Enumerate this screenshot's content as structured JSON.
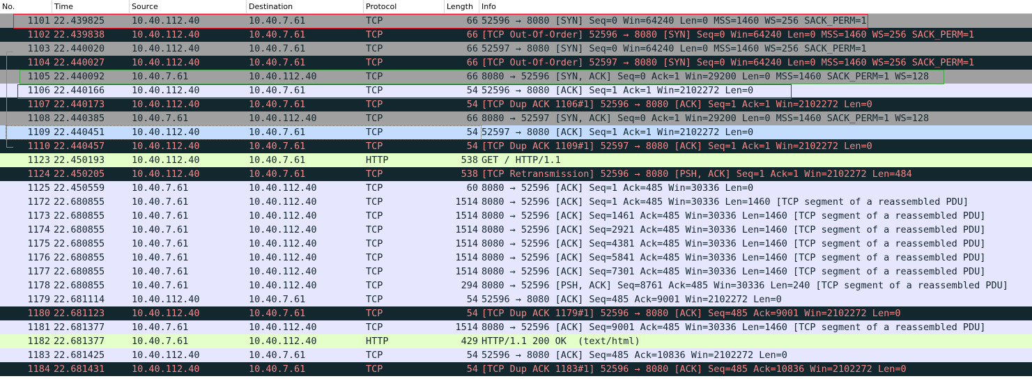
{
  "columns": {
    "no": "No.",
    "time": "Time",
    "source": "Source",
    "destination": "Destination",
    "protocol": "Protocol",
    "length": "Length",
    "info": "Info"
  },
  "colors": {
    "tcp_syn_bg": "#a0a0a0",
    "tcp_syn_fg": "#12272e",
    "tcp_bad_bg": "#12272e",
    "tcp_bad_fg": "#f78787",
    "tcp_bg": "#e7e6ff",
    "tcp_fg": "#12272e",
    "http_bg": "#e4ffc7",
    "http_fg": "#12272e",
    "selected_bg": "#c4dcff",
    "red_box": "#e8102a",
    "green_box": "#49a64b",
    "blue_box": "#3a3a8a"
  },
  "packets": [
    {
      "no": "1101",
      "time": "22.439825",
      "src": "10.40.112.40",
      "dst": "10.40.7.61",
      "proto": "TCP",
      "len": "66",
      "info": "52596 → 8080 [SYN] Seq=0 Win=64240 Len=0 MSS=1460 WS=256 SACK_PERM=1",
      "style": "syn"
    },
    {
      "no": "1102",
      "time": "22.439838",
      "src": "10.40.112.40",
      "dst": "10.40.7.61",
      "proto": "TCP",
      "len": "66",
      "info": "[TCP Out-Of-Order] 52596 → 8080 [SYN] Seq=0 Win=64240 Len=0 MSS=1460 WS=256 SACK_PERM=1",
      "style": "bad"
    },
    {
      "no": "1103",
      "time": "22.440020",
      "src": "10.40.112.40",
      "dst": "10.40.7.61",
      "proto": "TCP",
      "len": "66",
      "info": "52597 → 8080 [SYN] Seq=0 Win=64240 Len=0 MSS=1460 WS=256 SACK_PERM=1",
      "style": "syn"
    },
    {
      "no": "1104",
      "time": "22.440027",
      "src": "10.40.112.40",
      "dst": "10.40.7.61",
      "proto": "TCP",
      "len": "66",
      "info": "[TCP Out-Of-Order] 52597 → 8080 [SYN] Seq=0 Win=64240 Len=0 MSS=1460 WS=256 SACK_PERM=1",
      "style": "bad"
    },
    {
      "no": "1105",
      "time": "22.440092",
      "src": "10.40.7.61",
      "dst": "10.40.112.40",
      "proto": "TCP",
      "len": "66",
      "info": "8080 → 52596 [SYN, ACK] Seq=0 Ack=1 Win=29200 Len=0 MSS=1460 SACK_PERM=1 WS=128",
      "style": "syn"
    },
    {
      "no": "1106",
      "time": "22.440166",
      "src": "10.40.112.40",
      "dst": "10.40.7.61",
      "proto": "TCP",
      "len": "54",
      "info": "52596 → 8080 [ACK] Seq=1 Ack=1 Win=2102272 Len=0",
      "style": "tcp"
    },
    {
      "no": "1107",
      "time": "22.440173",
      "src": "10.40.112.40",
      "dst": "10.40.7.61",
      "proto": "TCP",
      "len": "54",
      "info": "[TCP Dup ACK 1106#1] 52596 → 8080 [ACK] Seq=1 Ack=1 Win=2102272 Len=0",
      "style": "bad"
    },
    {
      "no": "1108",
      "time": "22.440385",
      "src": "10.40.7.61",
      "dst": "10.40.112.40",
      "proto": "TCP",
      "len": "66",
      "info": "8080 → 52597 [SYN, ACK] Seq=0 Ack=1 Win=29200 Len=0 MSS=1460 SACK_PERM=1 WS=128",
      "style": "syn"
    },
    {
      "no": "1109",
      "time": "22.440451",
      "src": "10.40.112.40",
      "dst": "10.40.7.61",
      "proto": "TCP",
      "len": "54",
      "info": "52597 → 8080 [ACK] Seq=1 Ack=1 Win=2102272 Len=0",
      "style": "selected"
    },
    {
      "no": "1110",
      "time": "22.440457",
      "src": "10.40.112.40",
      "dst": "10.40.7.61",
      "proto": "TCP",
      "len": "54",
      "info": "[TCP Dup ACK 1109#1] 52597 → 8080 [ACK] Seq=1 Ack=1 Win=2102272 Len=0",
      "style": "bad"
    },
    {
      "no": "1123",
      "time": "22.450193",
      "src": "10.40.112.40",
      "dst": "10.40.7.61",
      "proto": "HTTP",
      "len": "538",
      "info": "GET / HTTP/1.1",
      "style": "http"
    },
    {
      "no": "1124",
      "time": "22.450205",
      "src": "10.40.112.40",
      "dst": "10.40.7.61",
      "proto": "TCP",
      "len": "538",
      "info": "[TCP Retransmission] 52596 → 8080 [PSH, ACK] Seq=1 Ack=1 Win=2102272 Len=484",
      "style": "bad"
    },
    {
      "no": "1125",
      "time": "22.450559",
      "src": "10.40.7.61",
      "dst": "10.40.112.40",
      "proto": "TCP",
      "len": "60",
      "info": "8080 → 52596 [ACK] Seq=1 Ack=485 Win=30336 Len=0",
      "style": "tcp"
    },
    {
      "no": "1172",
      "time": "22.680855",
      "src": "10.40.7.61",
      "dst": "10.40.112.40",
      "proto": "TCP",
      "len": "1514",
      "info": "8080 → 52596 [ACK] Seq=1 Ack=485 Win=30336 Len=1460 [TCP segment of a reassembled PDU]",
      "style": "tcp"
    },
    {
      "no": "1173",
      "time": "22.680855",
      "src": "10.40.7.61",
      "dst": "10.40.112.40",
      "proto": "TCP",
      "len": "1514",
      "info": "8080 → 52596 [ACK] Seq=1461 Ack=485 Win=30336 Len=1460 [TCP segment of a reassembled PDU]",
      "style": "tcp"
    },
    {
      "no": "1174",
      "time": "22.680855",
      "src": "10.40.7.61",
      "dst": "10.40.112.40",
      "proto": "TCP",
      "len": "1514",
      "info": "8080 → 52596 [ACK] Seq=2921 Ack=485 Win=30336 Len=1460 [TCP segment of a reassembled PDU]",
      "style": "tcp"
    },
    {
      "no": "1175",
      "time": "22.680855",
      "src": "10.40.7.61",
      "dst": "10.40.112.40",
      "proto": "TCP",
      "len": "1514",
      "info": "8080 → 52596 [ACK] Seq=4381 Ack=485 Win=30336 Len=1460 [TCP segment of a reassembled PDU]",
      "style": "tcp"
    },
    {
      "no": "1176",
      "time": "22.680855",
      "src": "10.40.7.61",
      "dst": "10.40.112.40",
      "proto": "TCP",
      "len": "1514",
      "info": "8080 → 52596 [ACK] Seq=5841 Ack=485 Win=30336 Len=1460 [TCP segment of a reassembled PDU]",
      "style": "tcp"
    },
    {
      "no": "1177",
      "time": "22.680855",
      "src": "10.40.7.61",
      "dst": "10.40.112.40",
      "proto": "TCP",
      "len": "1514",
      "info": "8080 → 52596 [ACK] Seq=7301 Ack=485 Win=30336 Len=1460 [TCP segment of a reassembled PDU]",
      "style": "tcp"
    },
    {
      "no": "1178",
      "time": "22.680855",
      "src": "10.40.7.61",
      "dst": "10.40.112.40",
      "proto": "TCP",
      "len": "294",
      "info": "8080 → 52596 [PSH, ACK] Seq=8761 Ack=485 Win=30336 Len=240 [TCP segment of a reassembled PDU]",
      "style": "tcp"
    },
    {
      "no": "1179",
      "time": "22.681114",
      "src": "10.40.112.40",
      "dst": "10.40.7.61",
      "proto": "TCP",
      "len": "54",
      "info": "52596 → 8080 [ACK] Seq=485 Ack=9001 Win=2102272 Len=0",
      "style": "tcp"
    },
    {
      "no": "1180",
      "time": "22.681123",
      "src": "10.40.112.40",
      "dst": "10.40.7.61",
      "proto": "TCP",
      "len": "54",
      "info": "[TCP Dup ACK 1179#1] 52596 → 8080 [ACK] Seq=485 Ack=9001 Win=2102272 Len=0",
      "style": "bad"
    },
    {
      "no": "1181",
      "time": "22.681377",
      "src": "10.40.7.61",
      "dst": "10.40.112.40",
      "proto": "TCP",
      "len": "1514",
      "info": "8080 → 52596 [ACK] Seq=9001 Ack=485 Win=30336 Len=1460 [TCP segment of a reassembled PDU]",
      "style": "tcp"
    },
    {
      "no": "1182",
      "time": "22.681377",
      "src": "10.40.7.61",
      "dst": "10.40.112.40",
      "proto": "HTTP",
      "len": "429",
      "info": "HTTP/1.1 200 OK  (text/html)",
      "style": "http"
    },
    {
      "no": "1183",
      "time": "22.681425",
      "src": "10.40.112.40",
      "dst": "10.40.7.61",
      "proto": "TCP",
      "len": "54",
      "info": "52596 → 8080 [ACK] Seq=485 Ack=10836 Win=2102272 Len=0",
      "style": "tcp"
    },
    {
      "no": "1184",
      "time": "22.681431",
      "src": "10.40.112.40",
      "dst": "10.40.7.61",
      "proto": "TCP",
      "len": "54",
      "info": "[TCP Dup ACK 1183#1] 52596 → 8080 [ACK] Seq=485 Ack=10836 Win=2102272 Len=0",
      "style": "bad"
    }
  ]
}
